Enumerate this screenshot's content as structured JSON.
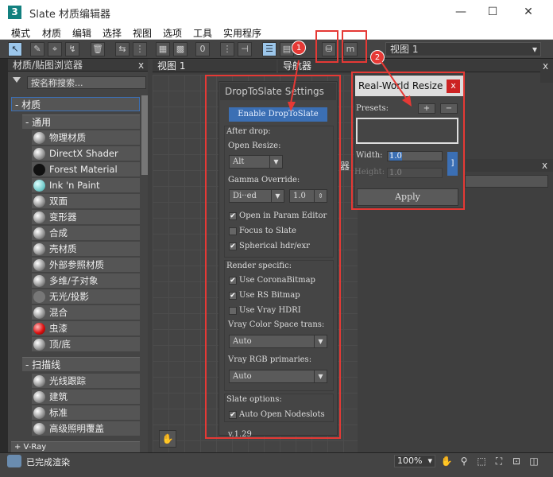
{
  "window": {
    "app_icon": "3",
    "title": "Slate 材质编辑器",
    "min": "—",
    "max": "☐",
    "close": "✕"
  },
  "menu": [
    "模式",
    "材质",
    "编辑",
    "选择",
    "视图",
    "选项",
    "工具",
    "实用程序"
  ],
  "toolbar": {
    "view_label": "视图 1",
    "view_arrow": "▾"
  },
  "browser": {
    "title": "材质/贴图浏览器",
    "close": "x",
    "search": "按名称搜索...",
    "section_material": "- 材质",
    "section_general": "- 通用",
    "items": [
      "物理材质",
      "DirectX Shader",
      "Forest Material",
      "Ink 'n Paint",
      "双面",
      "变形器",
      "合成",
      "壳材质",
      "外部参照材质",
      "多维/子对象",
      "无光/投影",
      "混合",
      "虫漆",
      "顶/底"
    ],
    "section_scanline": "- 扫描线",
    "scan_items": [
      "光线跟踪",
      "建筑",
      "标准",
      "高级照明覆盖"
    ],
    "section_vray": "+ V-Ray"
  },
  "viewport": {
    "view_tab": "视图 1",
    "navigator_tab": "导航器",
    "close": "x",
    "side_label": "器"
  },
  "dts": {
    "title": "DropToSlate Settings",
    "enable": "Enable DropToSlate",
    "after_drop": "After drop:",
    "open_resize": "Open Resize:",
    "open_resize_value": "Alt",
    "gamma_override": "Gamma Override:",
    "gamma_mode": "Di··ed",
    "gamma_value": "1.0",
    "open_in_param": "Open in Param Editor",
    "focus_slate": "Focus to Slate",
    "spherical": "Spherical hdr/exr",
    "render_specific": "Render specific:",
    "use_corona": "Use CoronaBitmap",
    "use_rs": "Use RS Bitmap",
    "use_vray": "Use Vray HDRI",
    "vray_cs": "Vray Color Space trans:",
    "vray_cs_value": "Auto",
    "vray_rgb": "Vray RGB primaries:",
    "vray_rgb_value": "Auto",
    "slate_options": "Slate options:",
    "auto_open": "Auto Open Nodeslots",
    "version": "v.1.29",
    "check": "✔"
  },
  "rwr": {
    "title": "Real-World Resize",
    "close": "x",
    "presets": "Presets:",
    "plus": "+",
    "minus": "−",
    "width_label": "Width:",
    "width_value": "1.0",
    "height_label": "Height:",
    "height_value": "1.0",
    "link": "]",
    "apply": "Apply"
  },
  "badges": [
    "1",
    "2"
  ],
  "status": {
    "text": "已完成渲染",
    "zoom": "100%",
    "zoom_arrow": "▾"
  },
  "colors": {
    "accent": "#3b6fb4",
    "annotation": "#e53935"
  }
}
